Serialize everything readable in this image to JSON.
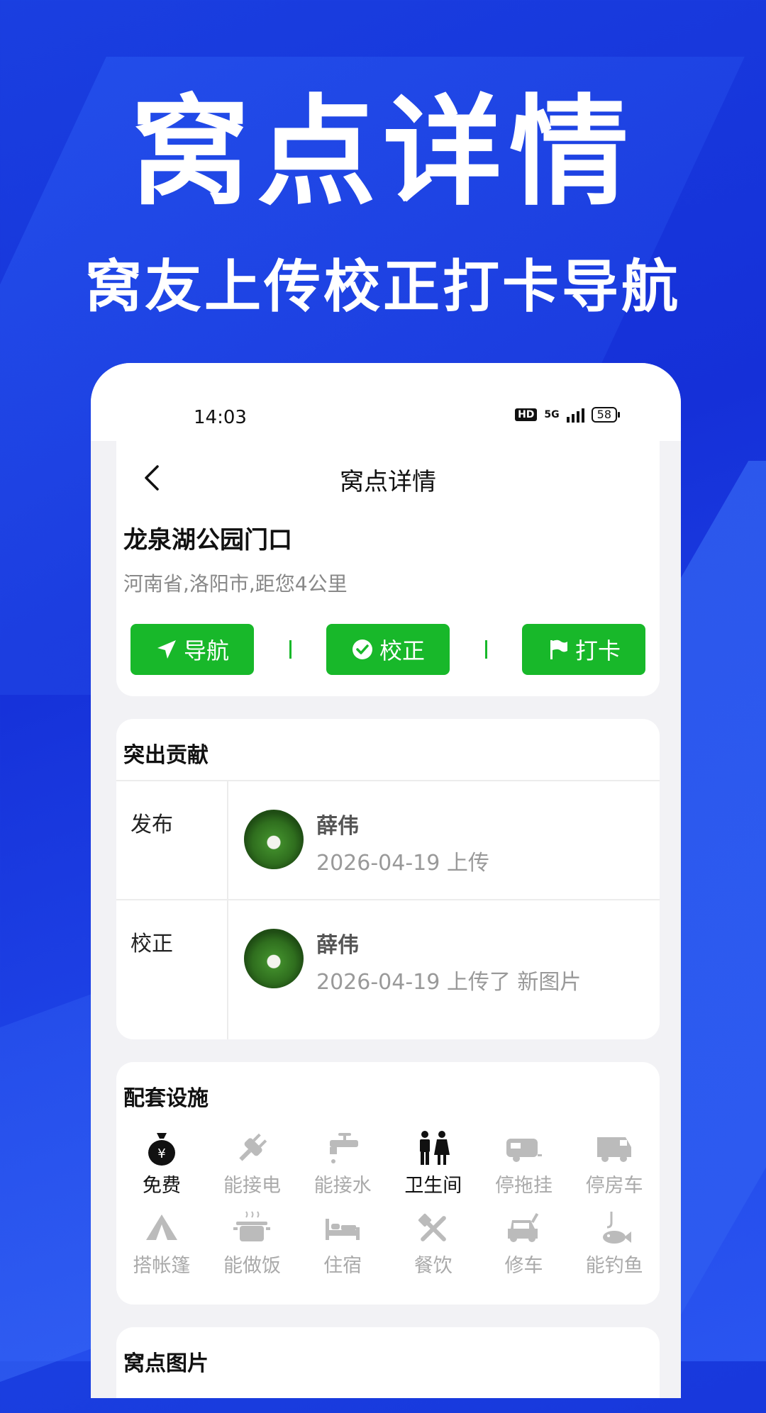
{
  "hero": {
    "title": "窝点详情",
    "subtitle": "窝友上传校正打卡导航"
  },
  "status_bar": {
    "time": "14:03",
    "network": "5G",
    "battery": "58"
  },
  "nav": {
    "title": "窝点详情"
  },
  "spot": {
    "name": "龙泉湖公园门口",
    "location": "河南省,洛阳市,距您4公里"
  },
  "actions": {
    "navigate_label": "导航",
    "correct_label": "校正",
    "checkin_label": "打卡"
  },
  "contributions": {
    "title": "突出贡献",
    "rows": [
      {
        "label": "发布",
        "user": "薛伟",
        "meta": "2026-04-19 上传"
      },
      {
        "label": "校正",
        "user": "薛伟",
        "meta": "2026-04-19 上传了 新图片"
      }
    ]
  },
  "facilities": {
    "title": "配套设施",
    "items": [
      {
        "label": "免费",
        "icon": "money-bag-icon",
        "available": true
      },
      {
        "label": "能接电",
        "icon": "plug-icon",
        "available": false
      },
      {
        "label": "能接水",
        "icon": "faucet-icon",
        "available": false
      },
      {
        "label": "卫生间",
        "icon": "restroom-icon",
        "available": true
      },
      {
        "label": "停拖挂",
        "icon": "trailer-icon",
        "available": false
      },
      {
        "label": "停房车",
        "icon": "rv-icon",
        "available": false
      },
      {
        "label": "搭帐篷",
        "icon": "tent-icon",
        "available": false
      },
      {
        "label": "能做饭",
        "icon": "cooking-pot-icon",
        "available": false
      },
      {
        "label": "住宿",
        "icon": "bed-icon",
        "available": false
      },
      {
        "label": "餐饮",
        "icon": "utensils-icon",
        "available": false
      },
      {
        "label": "修车",
        "icon": "car-repair-icon",
        "available": false
      },
      {
        "label": "能钓鱼",
        "icon": "fishing-icon",
        "available": false
      }
    ]
  },
  "photos": {
    "title": "窝点图片"
  },
  "colors": {
    "accent_green": "#18b82a",
    "background_blue": "#1a3fe0",
    "muted_gray": "#aaaaaa"
  }
}
